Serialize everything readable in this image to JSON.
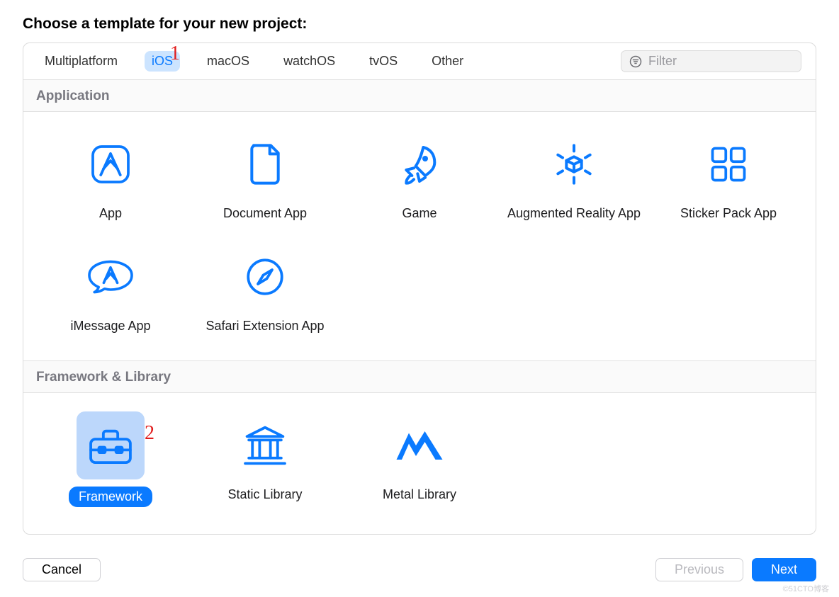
{
  "title": "Choose a template for your new project:",
  "tabs": {
    "multiplatform": "Multiplatform",
    "ios": "iOS",
    "macos": "macOS",
    "watchos": "watchOS",
    "tvos": "tvOS",
    "other": "Other"
  },
  "filter": {
    "placeholder": "Filter"
  },
  "sections": {
    "application": "Application",
    "framework": "Framework & Library"
  },
  "items": {
    "app": "App",
    "documentApp": "Document App",
    "game": "Game",
    "arApp": "Augmented Reality App",
    "stickerPack": "Sticker Pack App",
    "imessage": "iMessage App",
    "safariExt": "Safari Extension App",
    "framework": "Framework",
    "staticLib": "Static Library",
    "metalLib": "Metal Library"
  },
  "buttons": {
    "cancel": "Cancel",
    "previous": "Previous",
    "next": "Next"
  },
  "annotations": {
    "one": "1",
    "two": "2"
  },
  "watermark": "©51CTO博客"
}
